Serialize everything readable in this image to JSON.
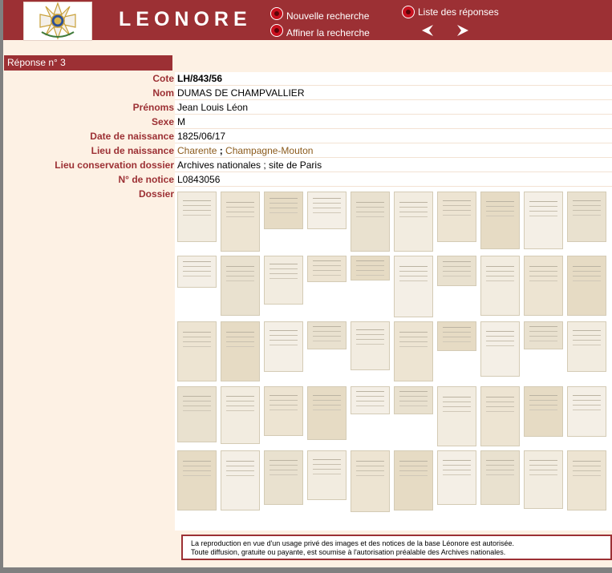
{
  "header": {
    "title": "LEONORE",
    "new_search": "Nouvelle recherche",
    "refine_search": "Affiner la recherche",
    "results_list": "Liste des réponses"
  },
  "record": {
    "heading": "Réponse n° 3",
    "fields": [
      {
        "label": "Cote",
        "value": "LH/843/56"
      },
      {
        "label": "Nom",
        "value": "DUMAS DE CHAMPVALLIER"
      },
      {
        "label": "Prénoms",
        "value": "Jean Louis Léon"
      },
      {
        "label": "Sexe",
        "value": "M"
      },
      {
        "label": "Date de naissance",
        "value": "1825/06/17"
      },
      {
        "label": "Lieu de naissance",
        "value_a": "Charente",
        "value_sep": " ; ",
        "value_b": "Champagne-Mouton"
      },
      {
        "label": "Lieu conservation dossier",
        "value": "Archives nationales ; site de Paris"
      },
      {
        "label": "N° de notice",
        "value": "L0843056"
      },
      {
        "label": "Dossier"
      }
    ]
  },
  "notice": {
    "line1": "La reproduction en vue d'un usage privé des images et des notices de la base Léonore est autorisée.",
    "line2": "Toute diffusion, gratuite ou payante, est soumise à l'autorisation préalable des Archives nationales."
  },
  "colors": {
    "brand": "#9c3034",
    "link": "#8b5a1b",
    "background": "#fdf1e4"
  }
}
